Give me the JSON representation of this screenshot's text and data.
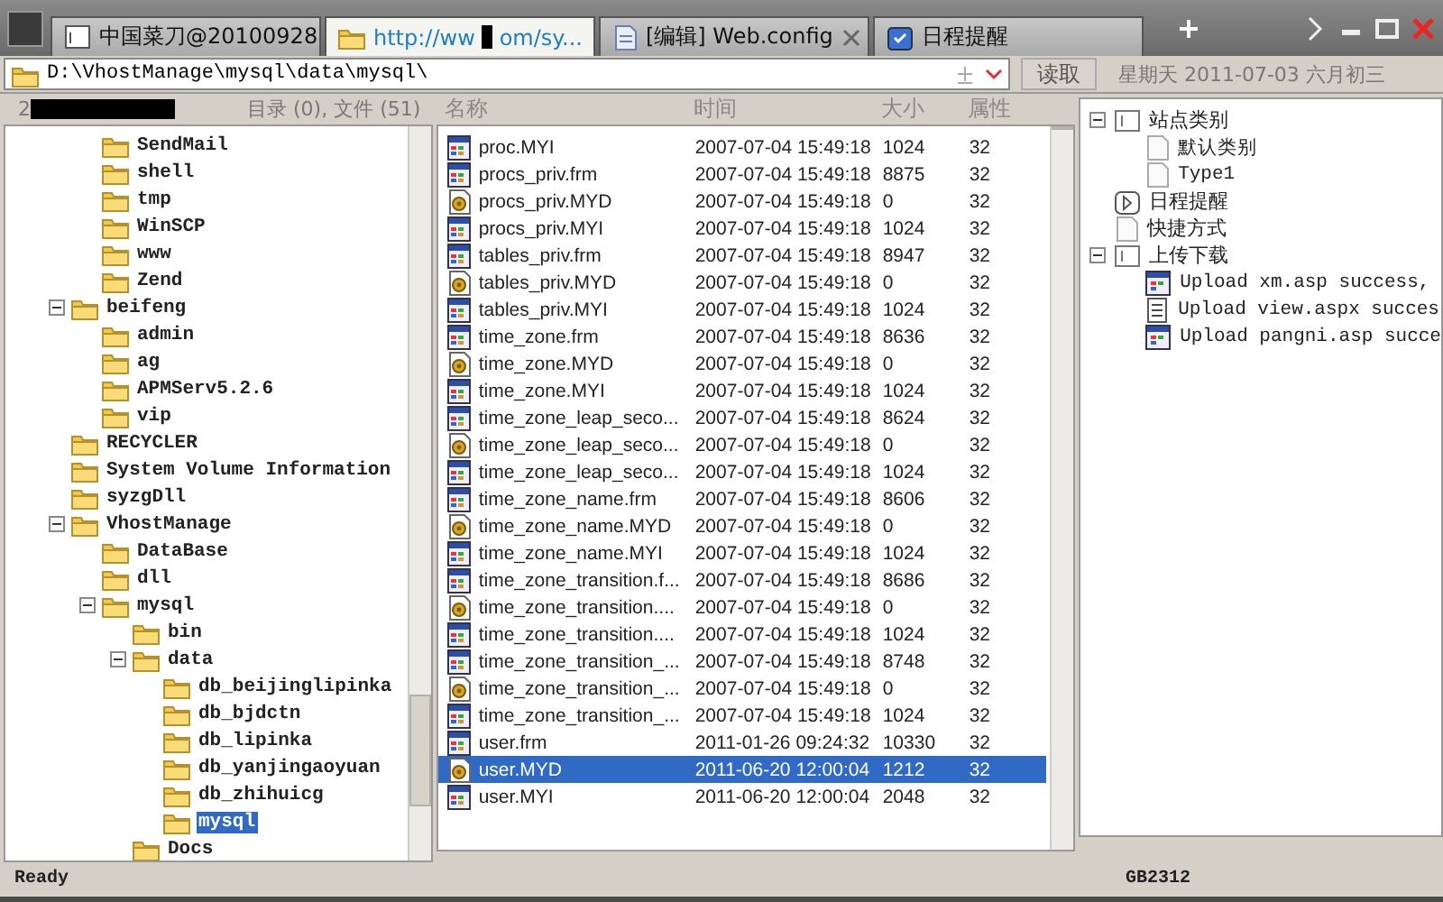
{
  "tabs": [
    {
      "kind": "app",
      "label": "中国菜刀@20100928",
      "selected": false,
      "closable": false
    },
    {
      "kind": "folder",
      "label": "http://ww",
      "label_tail": "om/sy...",
      "redacted": true,
      "selected": true,
      "closable": false
    },
    {
      "kind": "doc",
      "label": "[编辑] Web.config",
      "selected": false,
      "closable": true
    },
    {
      "kind": "calendar",
      "label": "日程提醒",
      "selected": false,
      "closable": false
    }
  ],
  "address": {
    "path": "D:\\VhostManage\\mysql\\data\\mysql\\",
    "read_button": "读取"
  },
  "date": "星期天 2011-07-03 六月初三",
  "tree": {
    "header_prefix": "2",
    "header_redacted": true,
    "summary": "目录 (0), 文件 (51)",
    "leading_items": [
      {
        "label": "SendMail",
        "selected": false
      },
      {
        "label": "shell",
        "selected": false
      },
      {
        "label": "tmp",
        "selected": false
      },
      {
        "label": "WinSCP",
        "selected": false
      },
      {
        "label": "www",
        "selected": false
      },
      {
        "label": "Zend",
        "selected": false
      }
    ],
    "items": [
      {
        "label": "beifeng",
        "selected": false,
        "expanded": true,
        "children": [
          {
            "label": "admin",
            "selected": false
          },
          {
            "label": "ag",
            "selected": false
          },
          {
            "label": "APMServ5.2.6",
            "selected": false
          },
          {
            "label": "vip",
            "selected": false
          }
        ]
      },
      {
        "label": "RECYCLER",
        "selected": false
      },
      {
        "label": "System Volume Information",
        "selected": false
      },
      {
        "label": "syzgDll",
        "selected": false
      },
      {
        "label": "VhostManage",
        "selected": false,
        "expanded": true,
        "children": [
          {
            "label": "DataBase",
            "selected": false
          },
          {
            "label": "dll",
            "selected": false
          },
          {
            "label": "mysql",
            "selected": false,
            "expanded": true,
            "children": [
              {
                "label": "bin",
                "selected": false
              },
              {
                "label": "data",
                "selected": false,
                "expanded": true,
                "children": [
                  {
                    "label": "db_beijinglipinka",
                    "selected": false
                  },
                  {
                    "label": "db_bjdctn",
                    "selected": false
                  },
                  {
                    "label": "db_lipinka",
                    "selected": false
                  },
                  {
                    "label": "db_yanjingaoyuan",
                    "selected": false
                  },
                  {
                    "label": "db_zhihuicg",
                    "selected": false
                  },
                  {
                    "label": "mysql",
                    "selected": true
                  }
                ]
              },
              {
                "label": "Docs",
                "selected": false
              }
            ]
          }
        ]
      }
    ]
  },
  "files": {
    "columns": [
      "名称",
      "时间",
      "大小",
      "属性"
    ],
    "rows": [
      {
        "kind": "table",
        "name": "proc.MYI",
        "time": "2007-07-04 15:49:18",
        "size": "1024",
        "attr": "32",
        "selected": false
      },
      {
        "kind": "table",
        "name": "procs_priv.frm",
        "time": "2007-07-04 15:49:18",
        "size": "8875",
        "attr": "32",
        "selected": false
      },
      {
        "kind": "data",
        "name": "procs_priv.MYD",
        "time": "2007-07-04 15:49:18",
        "size": "0",
        "attr": "32",
        "selected": false
      },
      {
        "kind": "table",
        "name": "procs_priv.MYI",
        "time": "2007-07-04 15:49:18",
        "size": "1024",
        "attr": "32",
        "selected": false
      },
      {
        "kind": "table",
        "name": "tables_priv.frm",
        "time": "2007-07-04 15:49:18",
        "size": "8947",
        "attr": "32",
        "selected": false
      },
      {
        "kind": "data",
        "name": "tables_priv.MYD",
        "time": "2007-07-04 15:49:18",
        "size": "0",
        "attr": "32",
        "selected": false
      },
      {
        "kind": "table",
        "name": "tables_priv.MYI",
        "time": "2007-07-04 15:49:18",
        "size": "1024",
        "attr": "32",
        "selected": false
      },
      {
        "kind": "table",
        "name": "time_zone.frm",
        "time": "2007-07-04 15:49:18",
        "size": "8636",
        "attr": "32",
        "selected": false
      },
      {
        "kind": "data",
        "name": "time_zone.MYD",
        "time": "2007-07-04 15:49:18",
        "size": "0",
        "attr": "32",
        "selected": false
      },
      {
        "kind": "table",
        "name": "time_zone.MYI",
        "time": "2007-07-04 15:49:18",
        "size": "1024",
        "attr": "32",
        "selected": false
      },
      {
        "kind": "table",
        "name": "time_zone_leap_seco...",
        "time": "2007-07-04 15:49:18",
        "size": "8624",
        "attr": "32",
        "selected": false
      },
      {
        "kind": "data",
        "name": "time_zone_leap_seco...",
        "time": "2007-07-04 15:49:18",
        "size": "0",
        "attr": "32",
        "selected": false
      },
      {
        "kind": "table",
        "name": "time_zone_leap_seco...",
        "time": "2007-07-04 15:49:18",
        "size": "1024",
        "attr": "32",
        "selected": false
      },
      {
        "kind": "table",
        "name": "time_zone_name.frm",
        "time": "2007-07-04 15:49:18",
        "size": "8606",
        "attr": "32",
        "selected": false
      },
      {
        "kind": "data",
        "name": "time_zone_name.MYD",
        "time": "2007-07-04 15:49:18",
        "size": "0",
        "attr": "32",
        "selected": false
      },
      {
        "kind": "table",
        "name": "time_zone_name.MYI",
        "time": "2007-07-04 15:49:18",
        "size": "1024",
        "attr": "32",
        "selected": false
      },
      {
        "kind": "table",
        "name": "time_zone_transition.f...",
        "time": "2007-07-04 15:49:18",
        "size": "8686",
        "attr": "32",
        "selected": false
      },
      {
        "kind": "data",
        "name": "time_zone_transition....",
        "time": "2007-07-04 15:49:18",
        "size": "0",
        "attr": "32",
        "selected": false
      },
      {
        "kind": "table",
        "name": "time_zone_transition....",
        "time": "2007-07-04 15:49:18",
        "size": "1024",
        "attr": "32",
        "selected": false
      },
      {
        "kind": "table",
        "name": "time_zone_transition_...",
        "time": "2007-07-04 15:49:18",
        "size": "8748",
        "attr": "32",
        "selected": false
      },
      {
        "kind": "data",
        "name": "time_zone_transition_...",
        "time": "2007-07-04 15:49:18",
        "size": "0",
        "attr": "32",
        "selected": false
      },
      {
        "kind": "table",
        "name": "time_zone_transition_...",
        "time": "2007-07-04 15:49:18",
        "size": "1024",
        "attr": "32",
        "selected": false
      },
      {
        "kind": "table",
        "name": "user.frm",
        "time": "2011-01-26 09:24:32",
        "size": "10330",
        "attr": "32",
        "selected": false
      },
      {
        "kind": "data",
        "name": "user.MYD",
        "time": "2011-06-20 12:00:04",
        "size": "1212",
        "attr": "32",
        "selected": true
      },
      {
        "kind": "table",
        "name": "user.MYI",
        "time": "2011-06-20 12:00:04",
        "size": "2048",
        "attr": "32",
        "selected": false
      }
    ]
  },
  "side": {
    "items": [
      {
        "kind": "group",
        "label": "站点类别",
        "expanded": true,
        "children": [
          {
            "kind": "page",
            "label": "默认类别"
          },
          {
            "kind": "page",
            "label": "Type1"
          }
        ]
      },
      {
        "kind": "clock",
        "label": "日程提醒"
      },
      {
        "kind": "page",
        "label": "快捷方式"
      },
      {
        "kind": "group",
        "label": "上传下载",
        "expanded": true,
        "children": [
          {
            "kind": "window",
            "label": "Upload xm.asp success,"
          },
          {
            "kind": "note",
            "label": "Upload view.aspx succes"
          },
          {
            "kind": "window",
            "label": "Upload pangni.asp succe"
          }
        ]
      }
    ]
  },
  "status": {
    "left": "Ready",
    "right": "GB2312"
  }
}
